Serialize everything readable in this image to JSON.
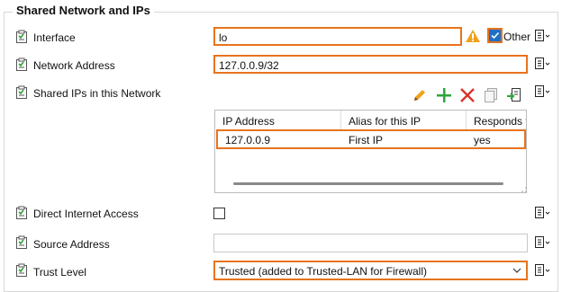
{
  "group_title": "Shared Network and IPs",
  "rows": {
    "interface": {
      "label": "Interface",
      "value": "lo",
      "other_label": "Other",
      "other_checked": true
    },
    "network_address": {
      "label": "Network Address",
      "value": "127.0.0.9/32"
    },
    "shared_ips": {
      "label": "Shared IPs in this Network",
      "columns": [
        "IP Address",
        "Alias for this IP",
        "Responds to"
      ],
      "rows": [
        {
          "ip": "127.0.0.9",
          "alias": "First IP",
          "responds": "yes"
        }
      ]
    },
    "direct_internet": {
      "label": "Direct Internet Access",
      "checked": false
    },
    "source_address": {
      "label": "Source Address",
      "value": ""
    },
    "trust_level": {
      "label": "Trust Level",
      "value": "Trusted (added to Trusted-LAN for Firewall)"
    }
  },
  "icons": {
    "row": "config-row-icon",
    "template": "template-menu-icon",
    "warning": "warning-icon",
    "edit": "edit-icon",
    "add": "add-icon",
    "delete": "delete-icon",
    "copy": "copy-icon",
    "import": "import-icon"
  },
  "colors": {
    "highlight": "#e8731c",
    "checkbox": "#1f6fc5",
    "add": "#2fa33a",
    "delete": "#d9342b",
    "edit": "#f0a21b",
    "warning": "#f0a21b"
  }
}
